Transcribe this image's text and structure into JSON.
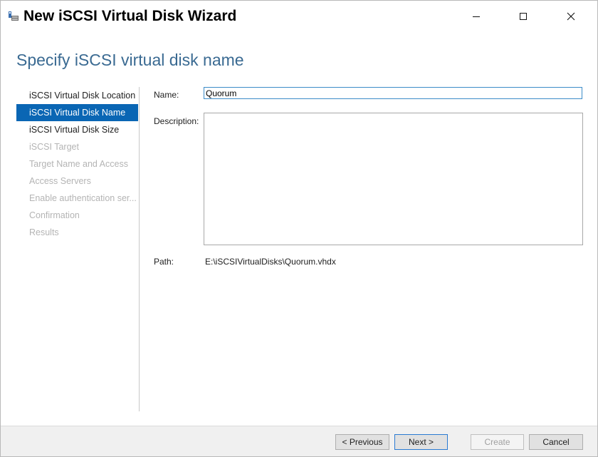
{
  "window": {
    "title": "New iSCSI Virtual Disk Wizard"
  },
  "page": {
    "heading": "Specify iSCSI virtual disk name"
  },
  "steps": [
    {
      "label": "iSCSI Virtual Disk Location",
      "state": "done"
    },
    {
      "label": "iSCSI Virtual Disk Name",
      "state": "selected"
    },
    {
      "label": "iSCSI Virtual Disk Size",
      "state": "enabled"
    },
    {
      "label": "iSCSI Target",
      "state": "disabled"
    },
    {
      "label": "Target Name and Access",
      "state": "disabled"
    },
    {
      "label": "Access Servers",
      "state": "disabled"
    },
    {
      "label": "Enable authentication ser...",
      "state": "disabled"
    },
    {
      "label": "Confirmation",
      "state": "disabled"
    },
    {
      "label": "Results",
      "state": "disabled"
    }
  ],
  "form": {
    "name_label": "Name:",
    "name_value": "Quorum",
    "description_label": "Description:",
    "description_value": "",
    "path_label": "Path:",
    "path_value": "E:\\iSCSIVirtualDisks\\Quorum.vhdx"
  },
  "buttons": {
    "previous": "< Previous",
    "next": "Next >",
    "create": "Create",
    "cancel": "Cancel"
  },
  "colors": {
    "heading": "#3a6a92",
    "selected_step": "#0a66b4",
    "disabled_text": "#b4b4b4"
  },
  "icons": {
    "app": "iscsi-disk-wizard-icon",
    "minimize": "minimize-icon",
    "maximize": "maximize-icon",
    "close": "close-icon"
  }
}
